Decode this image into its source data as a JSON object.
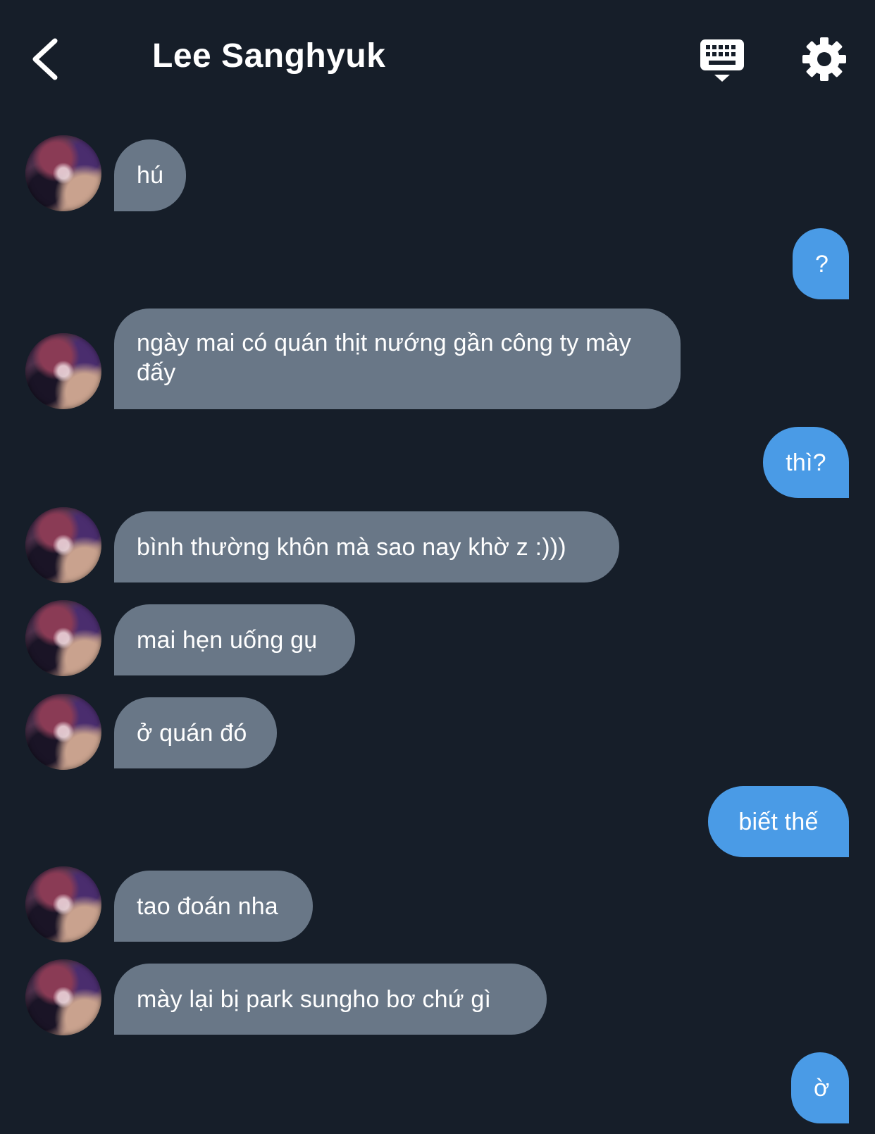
{
  "header": {
    "title": "Lee Sanghyuk",
    "back_icon": "chevron-left-icon",
    "keyboard_icon": "keyboard-icon",
    "settings_icon": "gear-icon"
  },
  "colors": {
    "background": "#161e29",
    "received_bubble": "#697787",
    "sent_bubble": "#4a9be6",
    "text": "#ffffff"
  },
  "messages": [
    {
      "from": "them",
      "text": "hú"
    },
    {
      "from": "me",
      "text": "?"
    },
    {
      "from": "them",
      "text": "ngày mai có quán thịt nướng gần công ty mày đấy"
    },
    {
      "from": "me",
      "text": "thì?"
    },
    {
      "from": "them",
      "text": "bình thường khôn mà sao nay khờ z :)))"
    },
    {
      "from": "them",
      "text": "mai hẹn uống gụ"
    },
    {
      "from": "them",
      "text": "ở quán đó"
    },
    {
      "from": "me",
      "text": "biết thế"
    },
    {
      "from": "them",
      "text": "tao đoán nha"
    },
    {
      "from": "them",
      "text": "mày lại bị park sungho bơ chứ gì"
    },
    {
      "from": "me",
      "text": "ờ"
    }
  ]
}
